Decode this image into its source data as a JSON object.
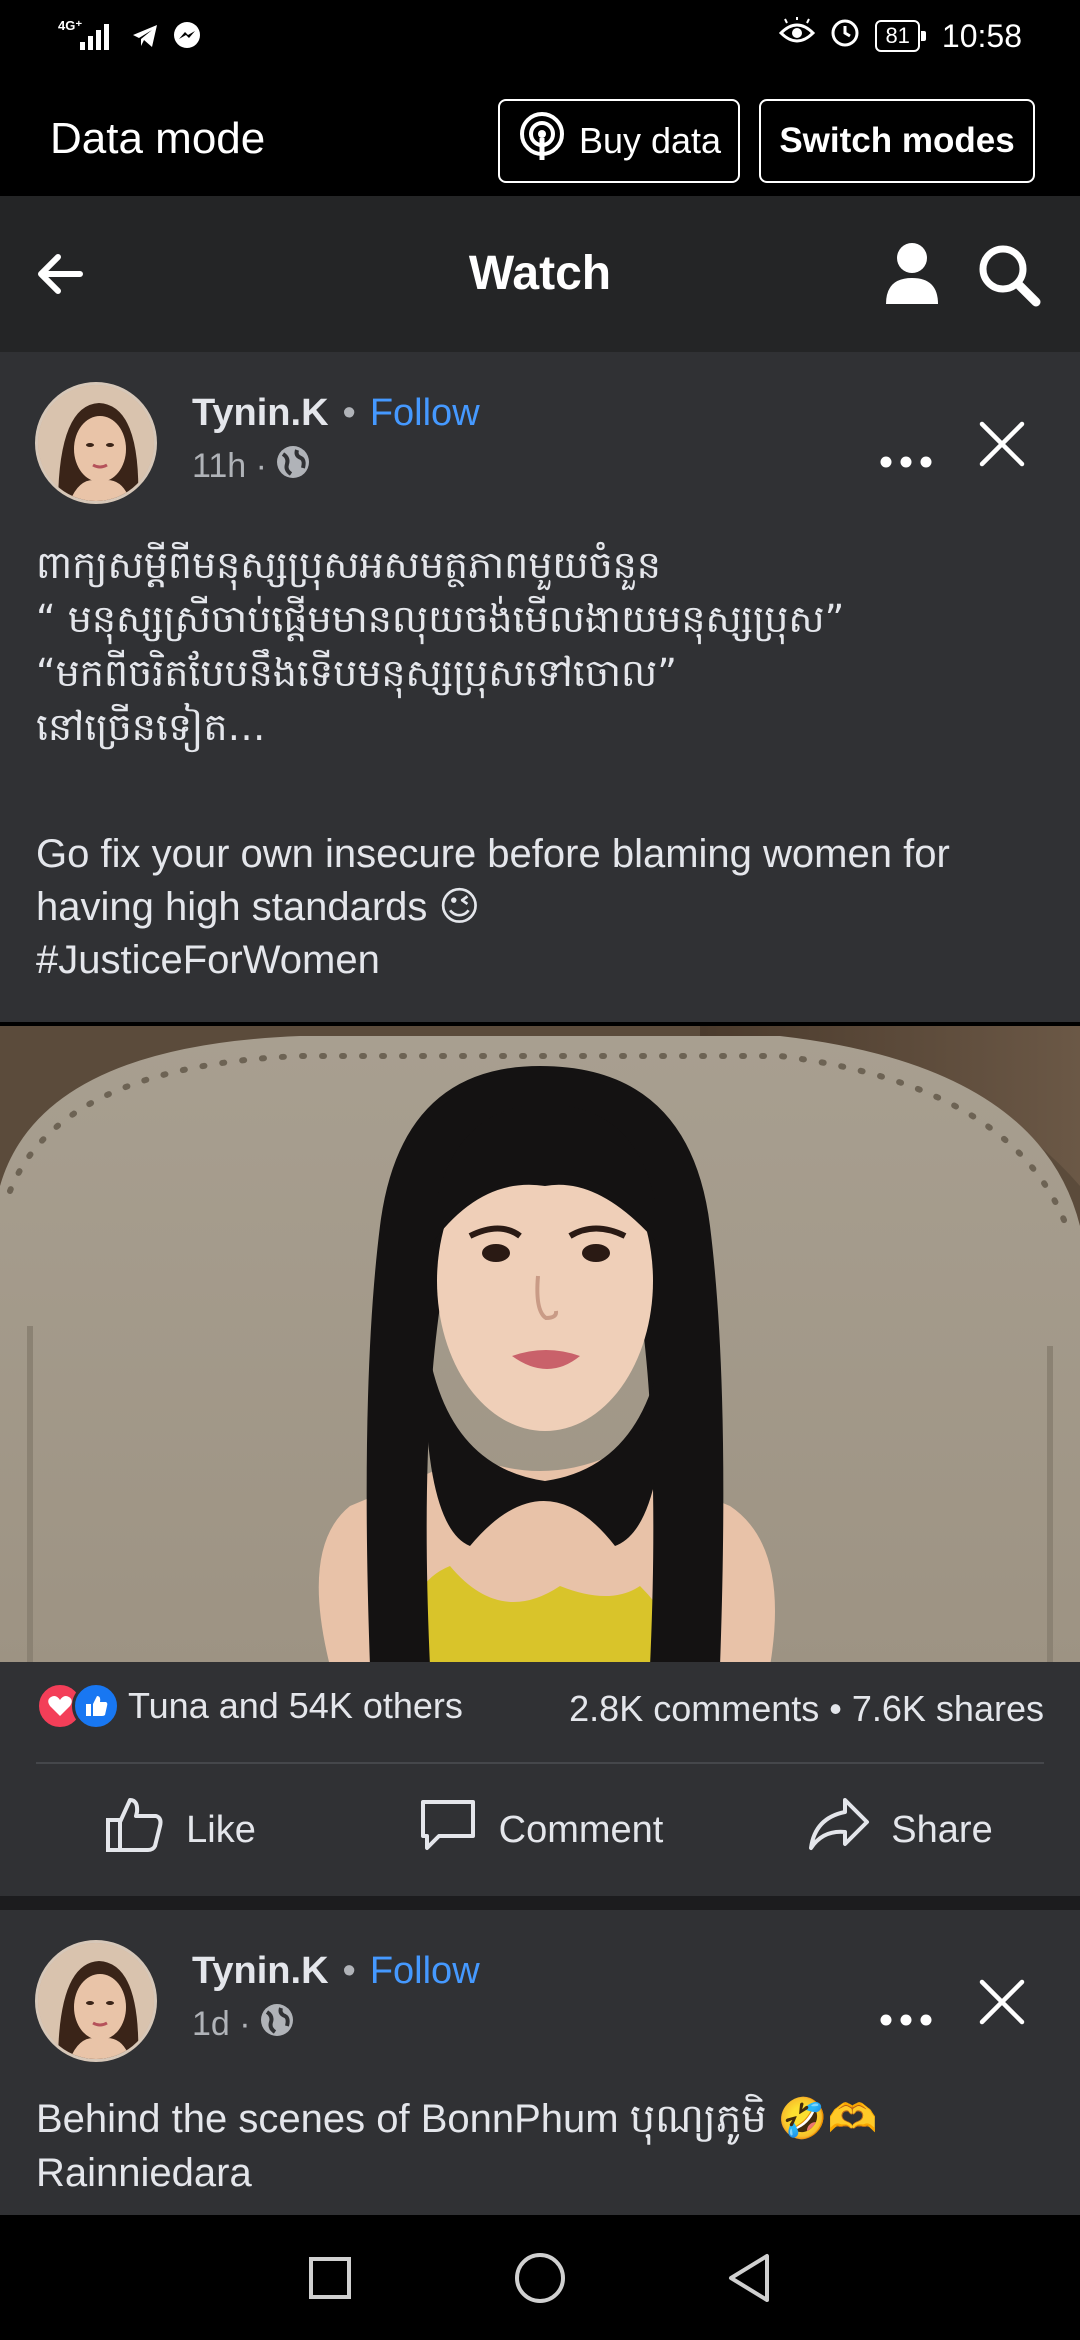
{
  "status_bar": {
    "network": "4G⁺",
    "battery": "81",
    "time": "10:58"
  },
  "data_bar": {
    "title": "Data mode",
    "buy_label": "Buy data",
    "switch_label": "Switch modes"
  },
  "header": {
    "title": "Watch"
  },
  "post1": {
    "author": "Tynin.K",
    "separator": "•",
    "follow_label": "Follow",
    "time": "11h ·",
    "khmer_lines": [
      "ពាក្យសម្តីពីមនុស្សប្រុសអសមត្ថភាពមួយចំនួន",
      "“ មនុស្សស្រីចាប់ផ្តើមមានលុយចង់មើលងាយមនុស្សប្រុស”",
      "“មកពីចរិតបែបនឹងទើបមនុស្សប្រុសទៅចោល”",
      "នៅច្រើនទៀត…"
    ],
    "english_text": "Go fix your own insecure before blaming women for having high standards 😉",
    "hashtag": "#JusticeForWomen",
    "reactions_text": "Tuna and 54K others",
    "comments": "2.8K comments",
    "counts_dot": "•",
    "shares": "7.6K shares",
    "like_label": "Like",
    "comment_label": "Comment",
    "share_label": "Share"
  },
  "post2": {
    "author": "Tynin.K",
    "separator": "•",
    "follow_label": "Follow",
    "time": "1d ·",
    "text": "Behind the scenes of BonnPhum បុណ្យភូមិ 🤣🫶",
    "text_line2": "Rainniedara"
  },
  "colors": {
    "accent_link": "#4599ff",
    "card_bg": "#303134",
    "header_bg": "#242526",
    "heart": "#f33e58",
    "like": "#1877f2"
  },
  "icons": [
    "signal-icon",
    "telegram-icon",
    "messenger-icon",
    "eye-icon",
    "alarm-icon",
    "battery-icon",
    "broadcast-icon",
    "back-arrow-icon",
    "person-icon",
    "search-icon",
    "globe-icon",
    "more-icon",
    "close-icon",
    "heart-reaction-icon",
    "like-reaction-icon",
    "thumbs-up-icon",
    "comment-icon",
    "share-icon",
    "square-nav-icon",
    "circle-nav-icon",
    "triangle-nav-icon"
  ]
}
